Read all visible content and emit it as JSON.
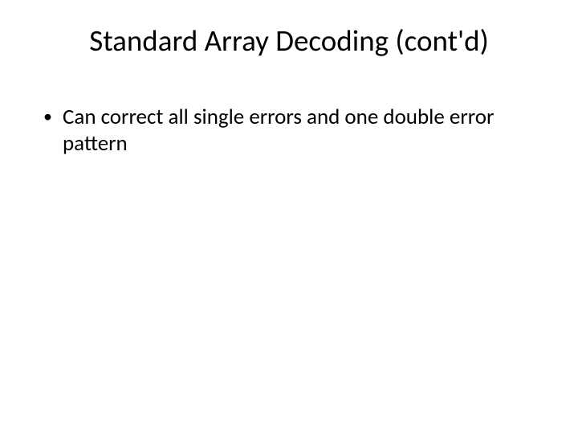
{
  "slide": {
    "title": "Standard Array Decoding (cont'd)",
    "bullets": [
      {
        "marker": "•",
        "text": "Can correct all single errors and one double error pattern"
      }
    ]
  }
}
